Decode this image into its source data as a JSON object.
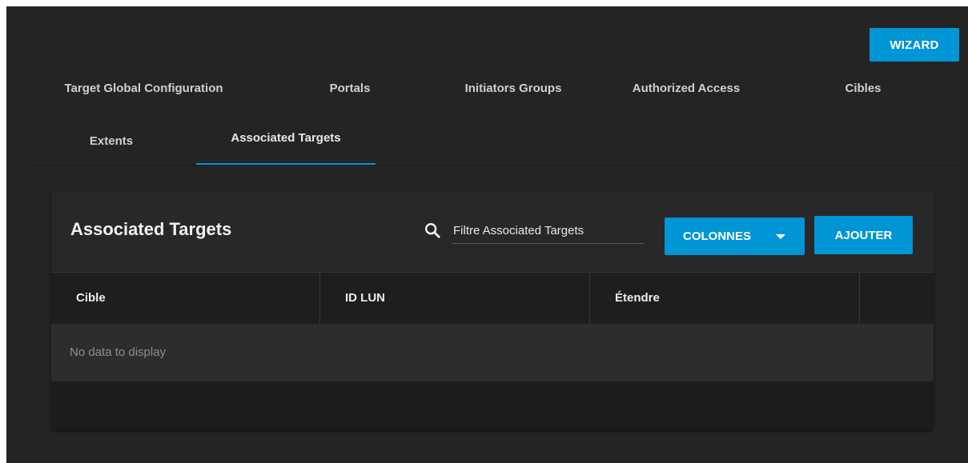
{
  "header": {
    "wizard_label": "WIZARD"
  },
  "tabs": [
    {
      "label": "Target Global Configuration",
      "active": false
    },
    {
      "label": "Portals",
      "active": false
    },
    {
      "label": "Initiators Groups",
      "active": false
    },
    {
      "label": "Authorized Access",
      "active": false
    },
    {
      "label": "Cibles",
      "active": false
    },
    {
      "label": "Extents",
      "active": false
    },
    {
      "label": "Associated Targets",
      "active": true
    }
  ],
  "card": {
    "title": "Associated Targets",
    "search": {
      "icon": "search-icon",
      "placeholder": "Filtre Associated Targets",
      "value": ""
    },
    "columns_label": "COLONNES",
    "add_label": "AJOUTER",
    "table": {
      "columns": [
        "Cible",
        "ID LUN",
        "Étendre"
      ],
      "rows": [],
      "empty_text": "No data to display"
    }
  },
  "colors": {
    "accent": "#0095d5",
    "background": "#242424",
    "card": "#282828"
  }
}
